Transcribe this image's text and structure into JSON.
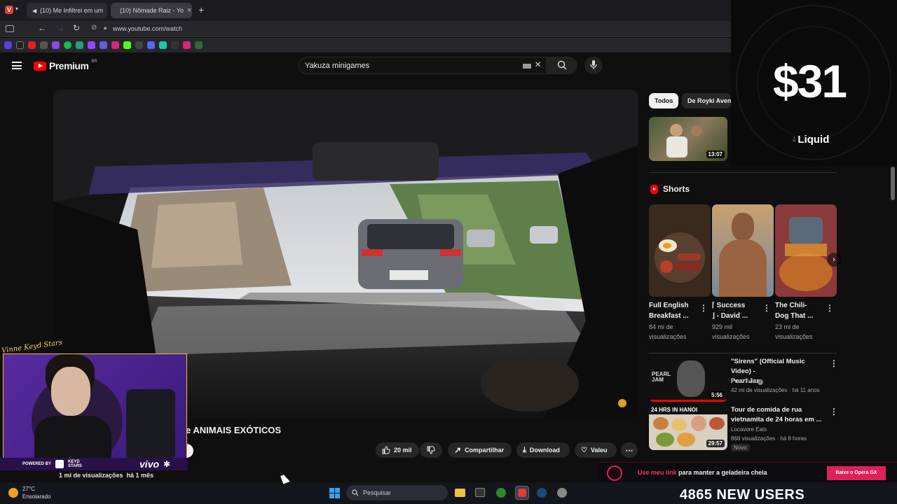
{
  "browser": {
    "tabs": [
      {
        "title": "(10) Me Infiltrei em um"
      },
      {
        "title": "(10) Nômade Raiz - Yo"
      }
    ],
    "url": "www.youtube.com/watch"
  },
  "youtube": {
    "logo": "Premium",
    "region": "BR",
    "search_value": "Yakuza minigames",
    "video_title_visible": "e ANIMAIS EXÓTICOS",
    "views_line": "1 mi de visualizações  há 1 mês",
    "actions": {
      "like_count": "20 mil",
      "share": "Compartilhar",
      "download": "Download",
      "thanks": "Valeu"
    },
    "chips": [
      "Todos",
      "De Royki Avent"
    ],
    "top_thumb_duration": "13:07",
    "shorts_heading": "Shorts",
    "shorts": [
      {
        "title_l1": "Full English",
        "title_l2": "Breakfast ...",
        "views_l1": "84 mi de",
        "views_l2": "visualizações"
      },
      {
        "title_l1": "⌈ Success",
        "title_l2": "⌋ - David ...",
        "views_l1": "929 mil",
        "views_l2": "visualizações"
      },
      {
        "title_l1": "The Chili-",
        "title_l2": "Dog That ...",
        "views_l1": "23 mi de",
        "views_l2": "visualizações"
      }
    ],
    "recs": [
      {
        "title_l1": "\"Sirens\" (Official Music Video) -",
        "title_l2": "Pearl Jam",
        "channel": "Pearl Jam",
        "meta": "42 mi de visualizações · há 11 anos",
        "duration": "5:56",
        "badge": ""
      },
      {
        "title_l1": "Tour de comida de rua",
        "title_l2": "vietnamita de 24 horas em ...",
        "channel": "Locavore Eats",
        "meta": "868 visualizações · há 8 horas",
        "duration": "29:57",
        "badge": "Novo"
      }
    ]
  },
  "overlay": {
    "price": "$31",
    "brand": "Liquid",
    "webcam_sign": "Vinne Keyd Stars",
    "powered_by": "POWERED BY",
    "powered_brand": "KEYD STARS",
    "sponsor": "vivo",
    "promo_highlight": "Use meu link",
    "promo_text": " para manter a geladeira cheia",
    "promo_button": "Baixe o Opera GX",
    "users_count": "4865 NEW USERS"
  },
  "taskbar": {
    "temp": "27°C",
    "weather": "Ensolarado",
    "search_placeholder": "Pesquisar"
  }
}
